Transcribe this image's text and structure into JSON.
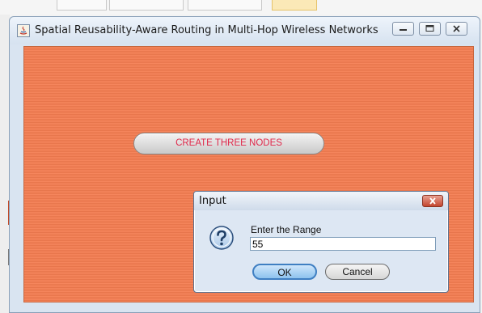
{
  "window": {
    "title": "Spatial Reusability-Aware Routing in Multi-Hop Wireless Networks",
    "background_color": "#f47c50"
  },
  "main": {
    "create_button_label": "CREATE THREE NODES",
    "create_button_text_color": "#e0284a"
  },
  "dialog": {
    "title": "Input",
    "prompt": "Enter the Range",
    "input_value": "55",
    "ok_label": "OK",
    "cancel_label": "Cancel"
  },
  "icons": {
    "app": "java-app-icon",
    "minimize": "minimize-icon",
    "maximize": "maximize-icon",
    "close": "close-icon",
    "question": "question-icon"
  }
}
